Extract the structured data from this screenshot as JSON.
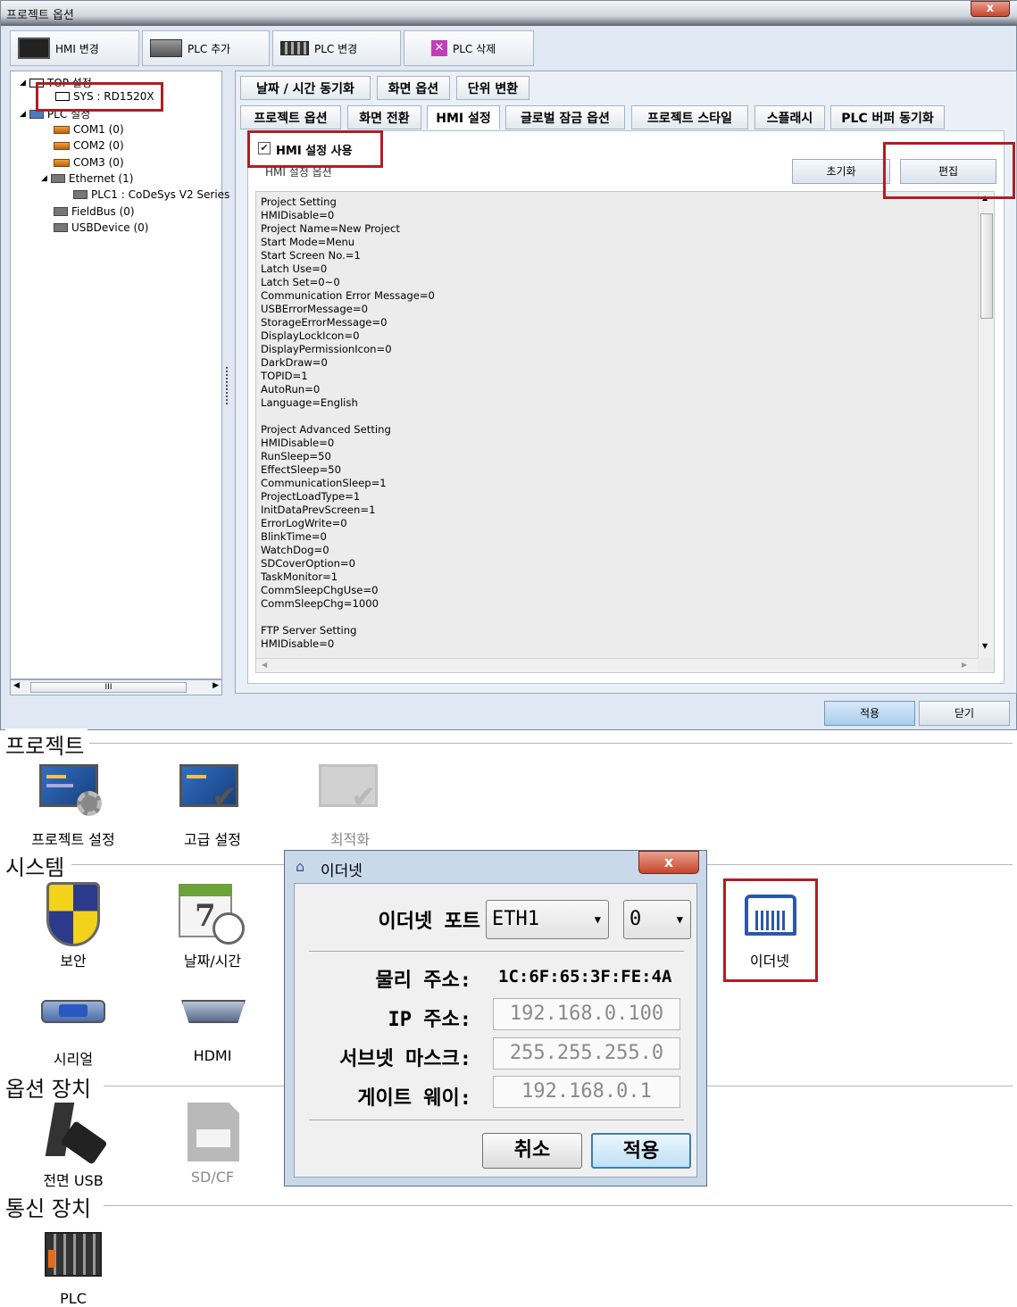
{
  "window": {
    "title": "프로젝트 옵션",
    "close": "x"
  },
  "toolbar": {
    "hmi_change": "HMI 변경",
    "plc_add": "PLC 추가",
    "plc_change": "PLC 변경",
    "plc_delete": "PLC 삭제"
  },
  "tree": {
    "top_settings": "TOP 설정",
    "sys": "SYS : RD1520X",
    "plc_settings": "PLC 설정",
    "com1": "COM1 (0)",
    "com2": "COM2 (0)",
    "com3": "COM3 (0)",
    "ethernet": "Ethernet (1)",
    "plc1": "PLC1 : CoDeSys V2 Series",
    "fieldbus": "FieldBus (0)",
    "usbdevice": "USBDevice (0)",
    "scroll_thumb": "III"
  },
  "tabs_row1": [
    "날짜 / 시간 동기화",
    "화면 옵션",
    "단위 변환"
  ],
  "tabs_row2": [
    "프로젝트 옵션",
    "화면 전환",
    "HMI 설정",
    "글로벌 잠금 옵션",
    "프로젝트 스타일",
    "스플래시",
    "PLC 버퍼 동기화"
  ],
  "hmi": {
    "use_checkbox": "HMI 설정 사용",
    "checked": true,
    "group_label": "HMI 설정 옵션",
    "reset_button": "초기화",
    "edit_button": "편집",
    "config_text": "Project Setting\nHMIDisable=0\nProject Name=New Project\nStart Mode=Menu\nStart Screen No.=1\nLatch Use=0\nLatch Set=0~0\nCommunication Error Message=0\nUSBErrorMessage=0\nStorageErrorMessage=0\nDisplayLockIcon=0\nDisplayPermissionIcon=0\nDarkDraw=0\nTOPID=1\nAutoRun=0\nLanguage=English\n\nProject Advanced Setting\nHMIDisable=0\nRunSleep=50\nEffectSleep=50\nCommunicationSleep=1\nProjectLoadType=1\nInitDataPrevScreen=1\nErrorLogWrite=0\nBlinkTime=0\nWatchDog=0\nSDCoverOption=0\nTaskMonitor=1\nCommSleepChgUse=0\nCommSleepChg=1000\n\nFTP Server Setting\nHMIDisable=0"
  },
  "bottom_buttons": {
    "apply": "적용",
    "close": "닫기"
  },
  "sections": {
    "project": "프로젝트",
    "system": "시스템",
    "option_device": "옵션 장치",
    "comm_device": "통신 장치"
  },
  "icons": {
    "project_settings": "프로젝트 설정",
    "advanced_settings": "고급 설정",
    "optimize": "최적화",
    "security": "보안",
    "date_time": "날짜/시간",
    "serial": "시리얼",
    "hdmi": "HDMI",
    "front_usb": "전면 USB",
    "sdcf": "SD/CF",
    "plc": "PLC",
    "ethernet": "이더넷",
    "calendar_digit": "7"
  },
  "ethernet_dialog": {
    "title": "이더넷",
    "close": "x",
    "port_label": "이더넷 포트",
    "port_value": "ETH1",
    "port_index": "0",
    "mac_label": "물리 주소:",
    "mac_value": "1C:6F:65:3F:FE:4A",
    "ip_label": "IP 주소:",
    "ip_value": "192.168.0.100",
    "subnet_label": "서브넷 마스크:",
    "subnet_value": "255.255.255.0",
    "gateway_label": "게이트 웨이:",
    "gateway_value": "192.168.0.1",
    "cancel": "취소",
    "apply": "적용"
  },
  "colors": {
    "highlight_red": "#b01e23",
    "window_bg": "#dfe8f3",
    "dialog_frame": "#c9d9ea"
  }
}
